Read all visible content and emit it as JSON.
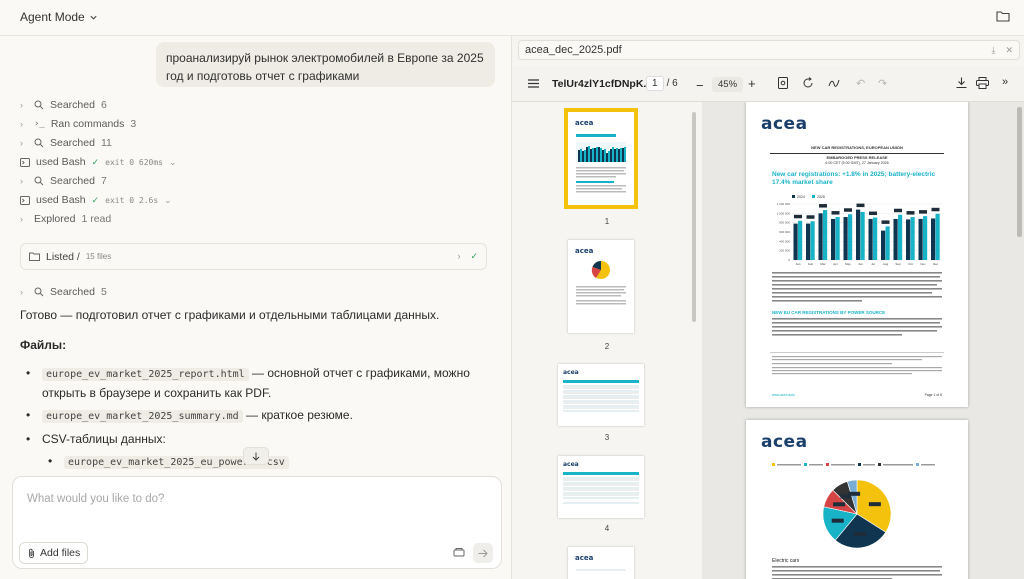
{
  "header": {
    "mode_label": "Agent Mode"
  },
  "user_message": "проанализируй рынок электромобилей в Европе за 2025 год и подготовь отчет с графиками",
  "steps": [
    {
      "label": "Searched",
      "count": "6"
    },
    {
      "label": "Ran commands",
      "count": "3"
    },
    {
      "label": "Searched",
      "count": "11"
    },
    {
      "label": "used Bash",
      "meta": "exit 0 620ms"
    },
    {
      "label": "Searched",
      "count": "7"
    },
    {
      "label": "used Bash",
      "meta": "exit 0 2.6s"
    },
    {
      "label": "Explored",
      "count": "1 read"
    }
  ],
  "listed": {
    "label": "Listed /",
    "sub": "15 files"
  },
  "step_after": {
    "label": "Searched",
    "count": "5"
  },
  "answer": {
    "intro": "Готово — подготовил отчет с графиками и отдельными таблицами данных.",
    "files_heading": "Файлы:",
    "items": [
      {
        "code": "europe_ev_market_2025_report.html",
        "text": " — основной отчет с графиками, можно открыть в браузере и сохранить как PDF."
      },
      {
        "code": "europe_ev_market_2025_summary.md",
        "text": " — краткое резюме."
      },
      {
        "text": "CSV-таблицы данных:"
      }
    ],
    "subitem_code": "europe_ev_market_2025_eu_power…n.csv"
  },
  "composer": {
    "placeholder": "What would you like to do?",
    "add_files": "Add files"
  },
  "pdf": {
    "filename": "acea_dec_2025.pdf",
    "doc_name": "TelUr4zlY1cfDNpK...",
    "page_current": "1",
    "page_total": "/ 6",
    "zoom": "45%",
    "thumb_numbers": [
      "1",
      "2",
      "3",
      "4"
    ],
    "page1": {
      "brand": "acea",
      "kicker": "NEW CAR REGISTRATIONS, EUROPEAN UNION",
      "embargo": "EMBARGOED PRESS RELEASE",
      "embargo_time": "6.00 CET (5.00 GMT), 27 January 2026",
      "headline": "New car registrations: +1.8% in 2025; battery-electric 17.4% market share",
      "section2": "NEW EU CAR REGISTRATIONS BY POWER SOURCE",
      "footer_left": "www.acea.auto",
      "footer_right": "Page 1 of 6"
    },
    "page2": {
      "brand": "acea",
      "caption": "Electric cars"
    }
  },
  "colors": {
    "accent_yellow": "#f4c20d",
    "acea_blue": "#1a3f6b",
    "teal": "#19b3c8",
    "dark": "#0f3550"
  },
  "chart_data": [
    {
      "type": "bar",
      "categories": [
        "Jan",
        "Feb",
        "Mar",
        "Apr",
        "May",
        "Jun",
        "Jul",
        "Aug",
        "Sep",
        "Oct",
        "Nov",
        "Dec"
      ],
      "series": [
        {
          "name": "2024",
          "values": [
            780,
            780,
            1000,
            880,
            920,
            1080,
            880,
            630,
            880,
            870,
            880,
            890
          ]
        },
        {
          "name": "2025",
          "values": [
            840,
            830,
            1070,
            920,
            980,
            1030,
            910,
            720,
            970,
            920,
            940,
            990
          ]
        }
      ],
      "ylim": [
        0,
        1200000
      ],
      "yticks": [
        "1 200 000",
        "1 000 000",
        "800 000",
        "600 000",
        "400 000",
        "200 000",
        "0"
      ],
      "legend_position": "top-left"
    },
    {
      "type": "pie",
      "categories": [
        "Battery-electric",
        "Plug-in hybrid",
        "Hybrid-electric",
        "Petrol",
        "Diesel",
        "Other"
      ],
      "values": [
        17.4,
        9.0,
        34.0,
        27.0,
        8.0,
        4.6
      ]
    }
  ]
}
